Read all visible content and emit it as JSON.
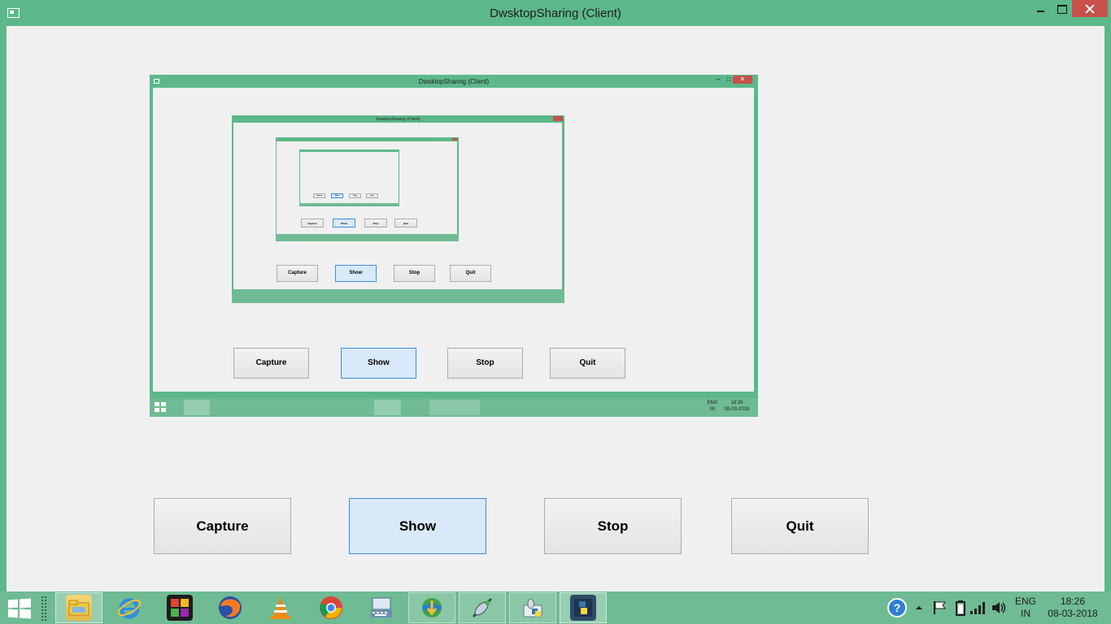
{
  "window": {
    "title": "DwsktopSharing (Client)",
    "minimize_label": "",
    "maximize_label": "",
    "close_label": ""
  },
  "buttons": {
    "capture": "Capture",
    "show": "Show",
    "stop": "Stop",
    "quit": "Quit"
  },
  "preview": {
    "title": "DwsktopSharing (Client)",
    "tray_lang": "ENG",
    "tray_region": "IN",
    "tray_time": "18:26",
    "tray_date": "08-03-2018"
  },
  "taskbar": {
    "apps": [
      "file-explorer",
      "internet-explorer",
      "photo-app",
      "firefox",
      "vlc",
      "chrome",
      "keyboard-app",
      "download-manager",
      "network-tool",
      "python-launcher",
      "python-idle"
    ],
    "tray": {
      "language": "ENG",
      "region": "IN",
      "time": "18:26",
      "date": "08-03-2018"
    }
  },
  "colors": {
    "frame": "#5cb88a",
    "client": "#f0f0f0",
    "close": "#c7504b",
    "button_active_border": "#3c8fd8",
    "button_active_fill": "#d9e9f9"
  }
}
